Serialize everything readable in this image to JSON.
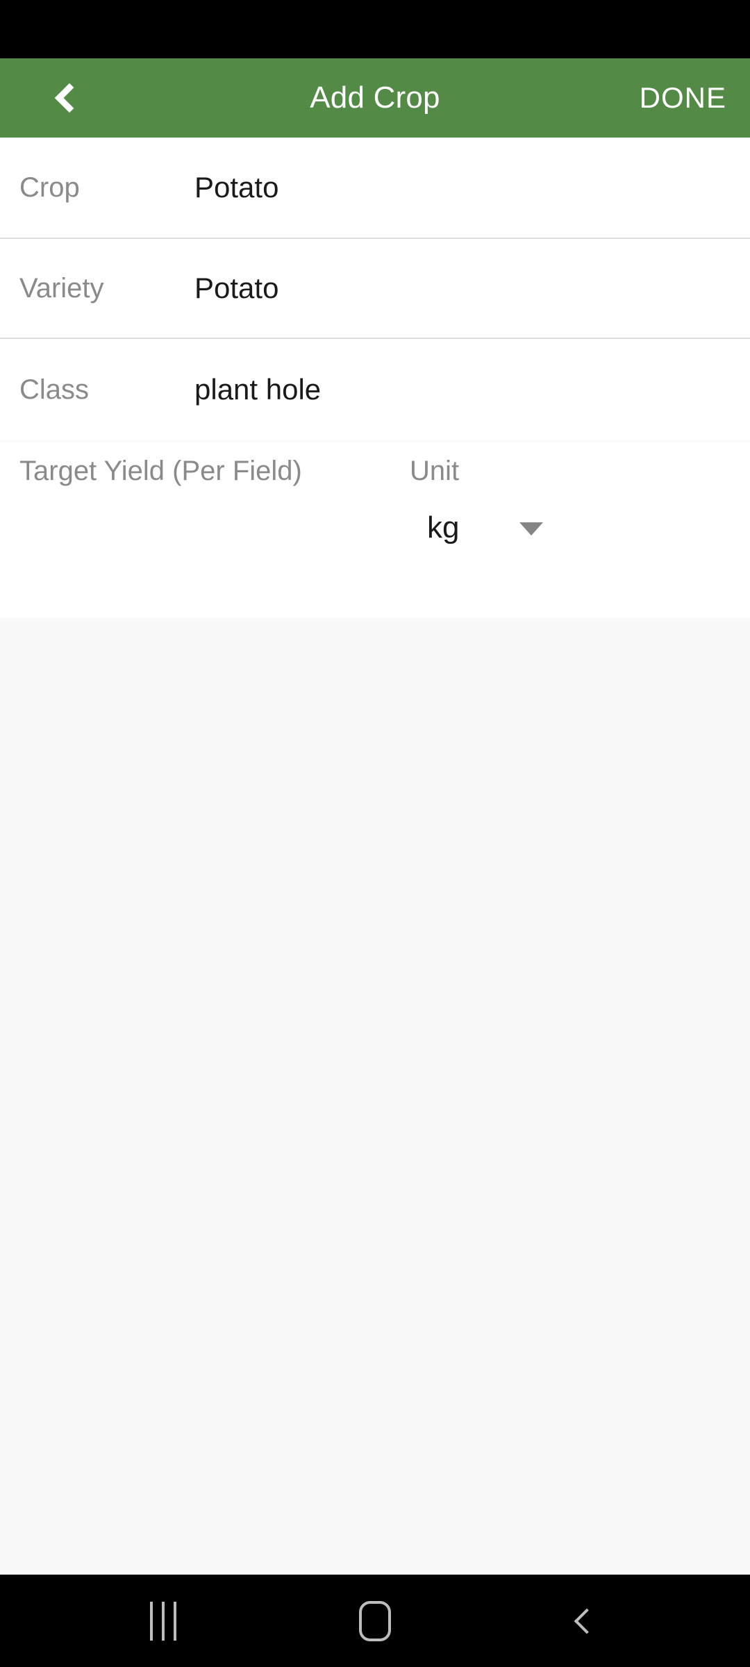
{
  "app_bar": {
    "title": "Add Crop",
    "back_icon": "chevron-left-icon",
    "done_label": "DONE",
    "background_color": "#538B46",
    "text_color": "#FFFFFF"
  },
  "form": {
    "rows": [
      {
        "label": "Crop",
        "value": "Potato"
      },
      {
        "label": "Variety",
        "value": "Potato"
      },
      {
        "label": "Class",
        "value": "plant hole"
      }
    ],
    "target_yield": {
      "label": "Target Yield (Per Field)",
      "value": "",
      "placeholder": ""
    },
    "unit": {
      "label": "Unit",
      "selected": "kg",
      "caret_icon": "caret-down-icon"
    }
  },
  "nav_bar": {
    "recents_icon": "recent-apps-icon",
    "home_icon": "home-icon",
    "back_icon": "back-icon",
    "icon_color": "#BDBDBD",
    "background_color": "#000000"
  },
  "colors": {
    "label_gray": "#8A8A8A",
    "value_black": "#1A1A1A",
    "divider": "#DCDCDC",
    "page_background": "#F8F8F8",
    "card_background": "#FFFFFF"
  }
}
